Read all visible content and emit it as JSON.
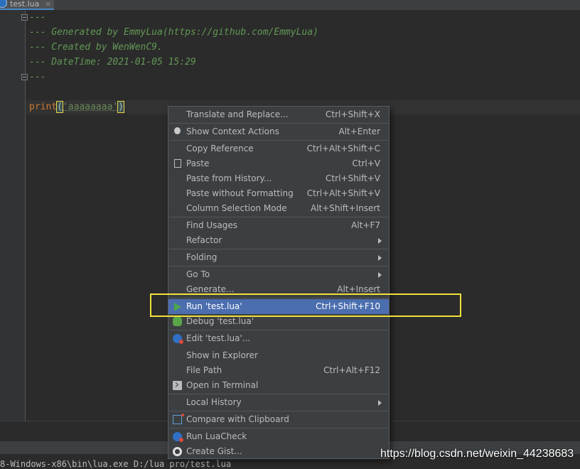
{
  "tab": {
    "label": "test.lua",
    "close": "×"
  },
  "editor": {
    "comment_lines": [
      "---",
      "--- Generated by EmmyLua(https://github.com/EmmyLua)",
      "--- Created by WenWenC9.",
      "--- DateTime: 2021-01-05 15:29",
      "---"
    ],
    "code": {
      "fn": "print",
      "open_paren": "(",
      "string": "'aaaaaaaa'",
      "close_paren": ")"
    }
  },
  "console": {
    "path_line": "8-Windows-x86\\bin\\lua.exe D:/lua pro/test.lua"
  },
  "context_menu": {
    "items": [
      {
        "label": "Translate and Replace...",
        "shortcut": "Ctrl+Shift+X",
        "icon": ""
      },
      {
        "label": "Show Context Actions",
        "shortcut": "Alt+Enter",
        "icon": "bulb-icon"
      },
      {
        "label": "Copy Reference",
        "shortcut": "Ctrl+Alt+Shift+C",
        "icon": ""
      },
      {
        "label": "Paste",
        "shortcut": "Ctrl+V",
        "icon": "clipboard-icon"
      },
      {
        "label": "Paste from History...",
        "shortcut": "Ctrl+Shift+V",
        "icon": ""
      },
      {
        "label": "Paste without Formatting",
        "shortcut": "Ctrl+Alt+Shift+V",
        "icon": ""
      },
      {
        "label": "Column Selection Mode",
        "shortcut": "Alt+Shift+Insert",
        "icon": ""
      },
      {
        "label": "Find Usages",
        "shortcut": "Alt+F7",
        "icon": ""
      },
      {
        "label": "Refactor",
        "shortcut": "",
        "icon": "",
        "submenu": true
      },
      {
        "label": "Folding",
        "shortcut": "",
        "icon": "",
        "submenu": true
      },
      {
        "label": "Go To",
        "shortcut": "",
        "icon": "",
        "submenu": true
      },
      {
        "label": "Generate...",
        "shortcut": "Alt+Insert",
        "icon": ""
      },
      {
        "label": "Run 'test.lua'",
        "shortcut": "Ctrl+Shift+F10",
        "icon": "run-icon",
        "selected": true
      },
      {
        "label": "Debug 'test.lua'",
        "shortcut": "",
        "icon": "debug-icon"
      },
      {
        "label": "Edit 'test.lua'...",
        "shortcut": "",
        "icon": "edit-config-icon"
      },
      {
        "label": "Show in Explorer",
        "shortcut": "",
        "icon": ""
      },
      {
        "label": "File Path",
        "shortcut": "Ctrl+Alt+F12",
        "icon": ""
      },
      {
        "label": "Open in Terminal",
        "shortcut": "",
        "icon": "terminal-icon"
      },
      {
        "label": "Local History",
        "shortcut": "",
        "icon": "",
        "submenu": true
      },
      {
        "label": "Compare with Clipboard",
        "shortcut": "",
        "icon": "compare-icon"
      },
      {
        "label": "Run LuaCheck",
        "shortcut": "",
        "icon": "luacheck-icon"
      },
      {
        "label": "Create Gist...",
        "shortcut": "",
        "icon": "github-icon"
      }
    ]
  },
  "watermark": "https://blog.csdn.net/weixin_44238683",
  "colors": {
    "menu_bg": "#3c3f41",
    "selection": "#4b6eaf",
    "highlight_box": "#f0e13a",
    "comment": "#629755"
  }
}
